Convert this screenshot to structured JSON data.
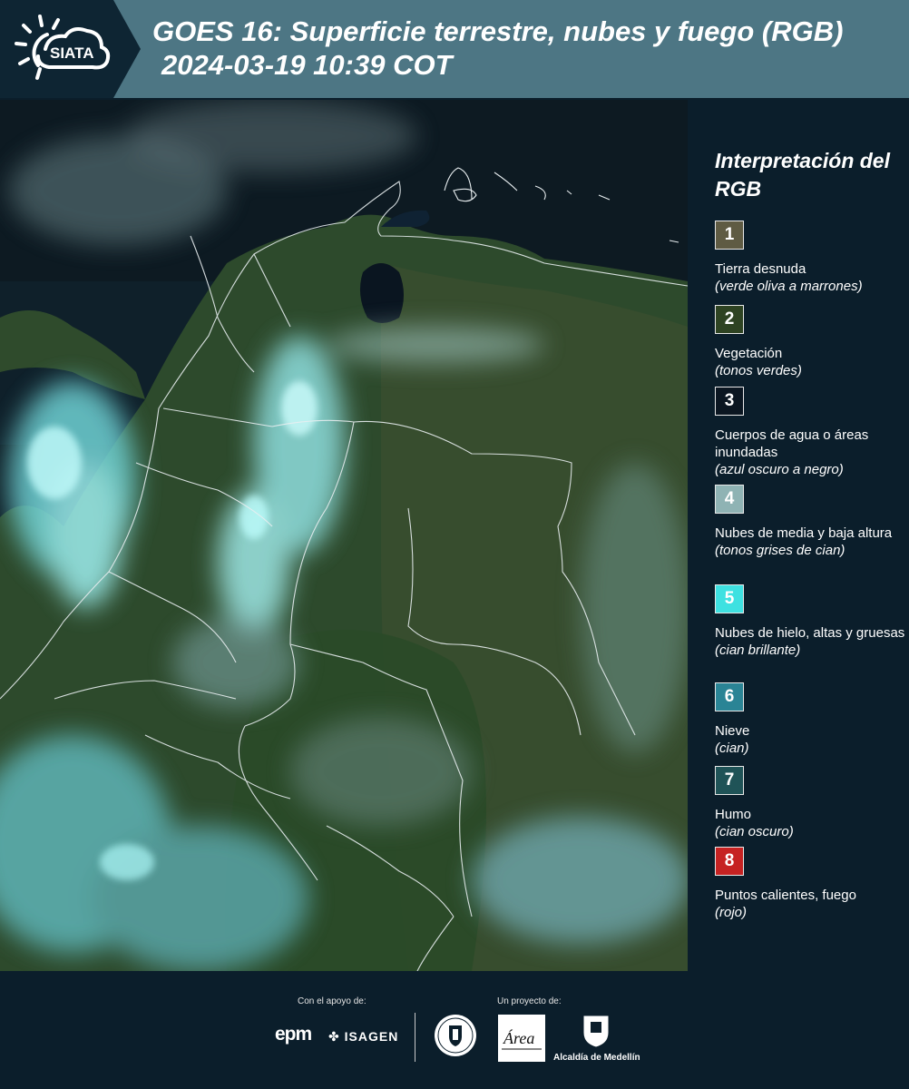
{
  "header": {
    "logo_text": "SIATA",
    "title_line1": "GOES 16: Superficie terrestre, nubes y fuego (RGB)",
    "title_line2": "2024-03-19 10:39 COT"
  },
  "legend": {
    "title": "Interpretación del RGB",
    "items": [
      {
        "number": "1",
        "label": "Tierra desnuda",
        "sub": "(verde oliva a marrones)",
        "color": "#5f5b43"
      },
      {
        "number": "2",
        "label": "Vegetación",
        "sub": "(tonos verdes)",
        "color": "#2e4322"
      },
      {
        "number": "3",
        "label": "Cuerpos de agua o áreas inundadas",
        "sub": "(azul oscuro a negro)",
        "color": "#0b1621"
      },
      {
        "number": "4",
        "label": "Nubes de media y baja altura",
        "sub": "(tonos grises de cian)",
        "color": "#8fb3b4"
      },
      {
        "number": "5",
        "label": "Nubes de hielo, altas y gruesas",
        "sub": "(cian brillante)",
        "color": "#3ee1e1"
      },
      {
        "number": "6",
        "label": "Nieve",
        "sub": "(cian)",
        "color": "#2a8495"
      },
      {
        "number": "7",
        "label": "Humo",
        "sub": "(cian oscuro)",
        "color": "#1f5357"
      },
      {
        "number": "8",
        "label": "Puntos calientes, fuego",
        "sub": "(rojo)",
        "color": "#c62222"
      }
    ]
  },
  "footer": {
    "support_label": "Con el apoyo de:",
    "project_label": "Un proyecto de:",
    "epm": "epm",
    "isagen": "ISAGEN",
    "alcaldia": "Alcaldía de Medellín",
    "area_text": "Área"
  }
}
